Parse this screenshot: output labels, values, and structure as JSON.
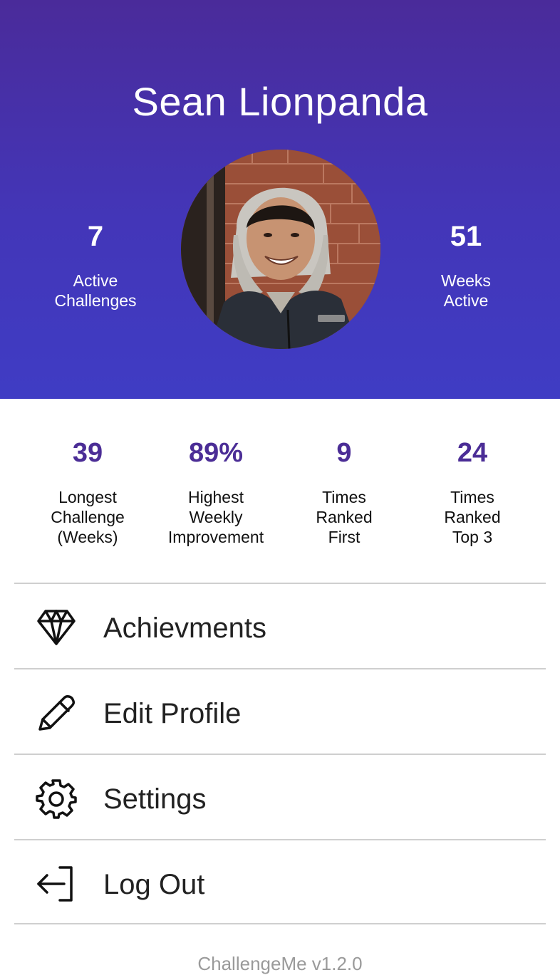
{
  "profile": {
    "name": "Sean Lionpanda",
    "active_challenges": {
      "value": "7",
      "label": "Active\nChallenges"
    },
    "weeks_active": {
      "value": "51",
      "label": "Weeks\nActive"
    }
  },
  "stats": [
    {
      "value": "39",
      "label": "Longest\nChallenge\n(Weeks)"
    },
    {
      "value": "89%",
      "label": "Highest\nWeekly\nImprovement"
    },
    {
      "value": "9",
      "label": "Times\nRanked\nFirst"
    },
    {
      "value": "24",
      "label": "Times\nRanked\nTop 3"
    }
  ],
  "menu": [
    {
      "label": "Achievments",
      "icon": "diamond-icon"
    },
    {
      "label": "Edit Profile",
      "icon": "pencil-icon"
    },
    {
      "label": "Settings",
      "icon": "gear-icon"
    },
    {
      "label": "Log Out",
      "icon": "logout-icon"
    }
  ],
  "footer": {
    "version": "ChallengeMe v1.2.0"
  },
  "colors": {
    "header_gradient_top": "#4a2b9a",
    "header_gradient_bottom": "#3f3cc4",
    "accent": "#4b2d96",
    "divider": "#cfcfcf",
    "version_text": "#9a9a9a"
  }
}
